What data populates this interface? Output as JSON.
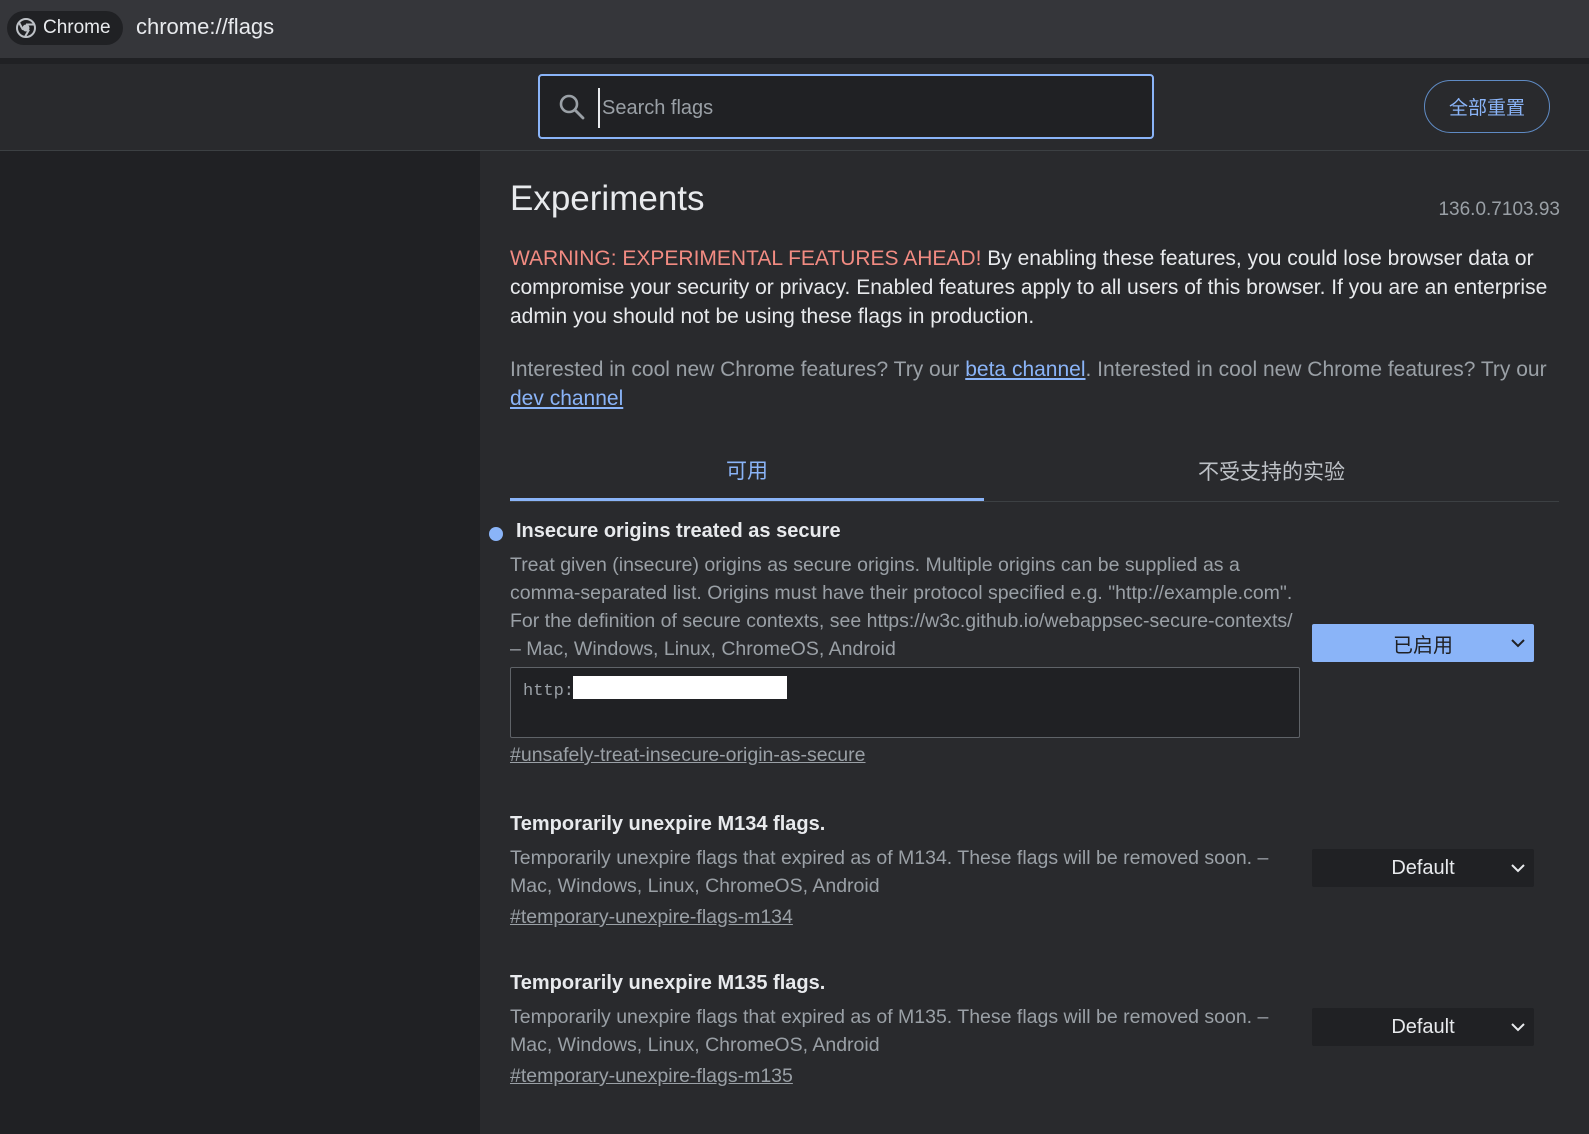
{
  "addressbar": {
    "chip_label": "Chrome",
    "url": "chrome://flags"
  },
  "header": {
    "search_placeholder": "Search flags",
    "reset_label": "全部重置"
  },
  "content": {
    "title": "Experiments",
    "version": "136.0.7103.93",
    "warning_prefix": "WARNING: EXPERIMENTAL FEATURES AHEAD!",
    "warning_text": " By enabling these features, you could lose browser data or compromise your security or privacy. Enabled features apply to all users of this browser. If you are an enterprise admin you should not be using these flags in production.",
    "interest_1": "Interested in cool new Chrome features? Try our ",
    "beta_link": "beta channel",
    "interest_2": ". Interested in cool new Chrome features? Try our ",
    "dev_link": "dev channel"
  },
  "tabs": [
    {
      "label": "可用",
      "active": true
    },
    {
      "label": "不受支持的实验",
      "active": false
    }
  ],
  "flags": [
    {
      "title": "Insecure origins treated as secure",
      "description": "Treat given (insecure) origins as secure origins. Multiple origins can be supplied as a comma-separated list. Origins must have their protocol specified e.g. \"http://example.com\". For the definition of secure contexts, see https://w3c.github.io/webappsec-secure-contexts/ – Mac, Windows, Linux, ChromeOS, Android",
      "textarea_value": "http:",
      "link": "#unsafely-treat-insecure-origin-as-secure",
      "select_value": "已启用",
      "modified": true
    },
    {
      "title": "Temporarily unexpire M134 flags.",
      "description": "Temporarily unexpire flags that expired as of M134. These flags will be removed soon. – Mac, Windows, Linux, ChromeOS, Android",
      "link": "#temporary-unexpire-flags-m134",
      "select_value": "Default",
      "modified": false
    },
    {
      "title": "Temporarily unexpire M135 flags.",
      "description": "Temporarily unexpire flags that expired as of M135. These flags will be removed soon. – Mac, Windows, Linux, ChromeOS, Android",
      "link": "#temporary-unexpire-flags-m135",
      "select_value": "Default",
      "modified": false
    }
  ],
  "colors": {
    "background": "#202124",
    "panel": "#292a2d",
    "accent": "#8ab4f8",
    "warning": "#f28b82",
    "secondary_text": "#9aa0a6"
  }
}
